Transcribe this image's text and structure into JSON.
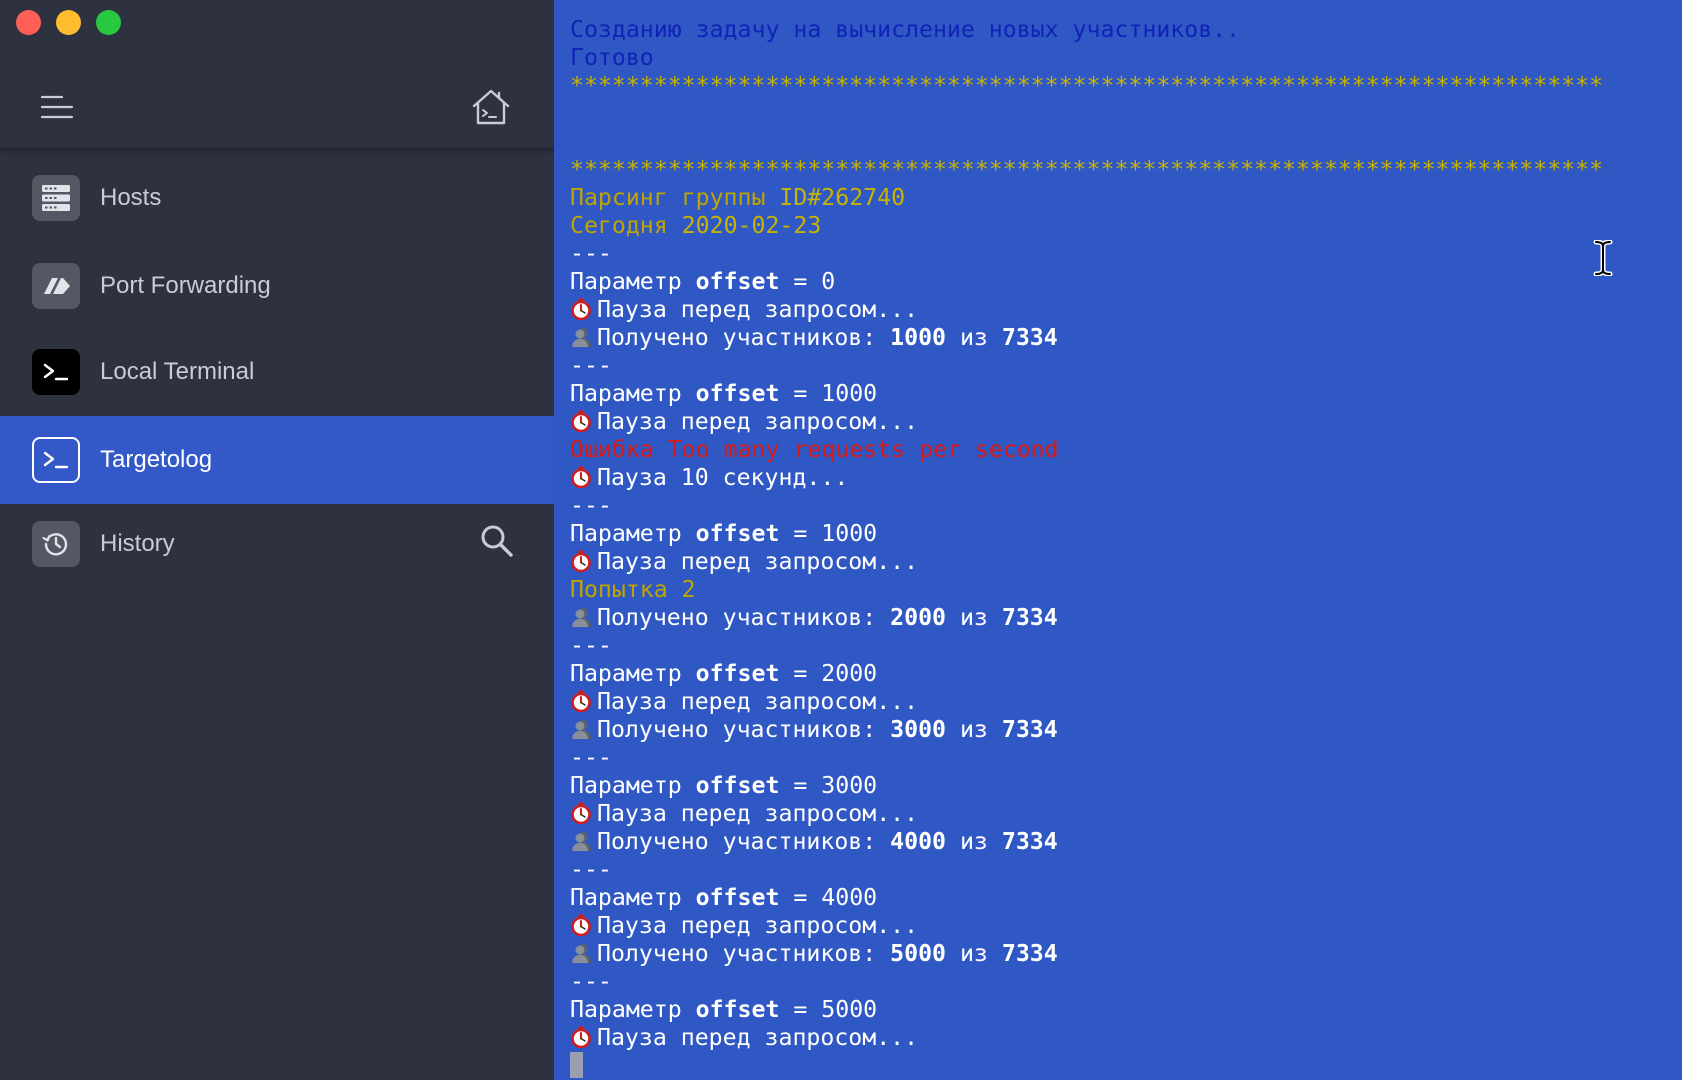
{
  "sidebar": {
    "items": [
      {
        "label": "Hosts",
        "icon": "server-icon"
      },
      {
        "label": "Port Forwarding",
        "icon": "port-forwarding-icon"
      },
      {
        "label": "Local Terminal",
        "icon": "terminal-prompt-icon"
      },
      {
        "label": "Targetolog",
        "icon": "terminal-prompt-icon",
        "active": true
      },
      {
        "label": "History",
        "icon": "history-icon"
      }
    ]
  },
  "terminal": {
    "lines": [
      {
        "segments": [
          {
            "t": "Созданию задачу на вычисление новых участников..",
            "c": "c-blue"
          }
        ]
      },
      {
        "segments": [
          {
            "t": "Готово",
            "c": "c-blue"
          }
        ]
      },
      {
        "segments": [
          {
            "t": "**************************************************************************",
            "c": "c-yellow"
          }
        ]
      },
      {
        "segments": []
      },
      {
        "segments": []
      },
      {
        "segments": [
          {
            "t": "**************************************************************************",
            "c": "c-yellow"
          }
        ]
      },
      {
        "segments": [
          {
            "t": "Парсинг группы ",
            "c": "c-olive"
          },
          {
            "t": "ID#262740",
            "c": "c-yellow"
          }
        ]
      },
      {
        "segments": [
          {
            "t": "Сегодня ",
            "c": "c-olive"
          },
          {
            "t": "2020-02-23",
            "c": "c-yellow"
          }
        ]
      },
      {
        "segments": [
          {
            "t": "---",
            "c": "c-white"
          }
        ]
      },
      {
        "segments": [
          {
            "t": "Параметр ",
            "c": "c-white"
          },
          {
            "t": "offset",
            "c": "c-white bold"
          },
          {
            "t": " = 0",
            "c": "c-white"
          }
        ]
      },
      {
        "icon": "timer",
        "segments": [
          {
            "t": "Пауза перед запросом...",
            "c": "c-white"
          }
        ]
      },
      {
        "icon": "user",
        "segments": [
          {
            "t": "Получено участников: ",
            "c": "c-white"
          },
          {
            "t": "1000",
            "c": "c-white bold"
          },
          {
            "t": " из ",
            "c": "c-white"
          },
          {
            "t": "7334",
            "c": "c-white bold"
          }
        ]
      },
      {
        "segments": [
          {
            "t": "---",
            "c": "c-white"
          }
        ]
      },
      {
        "segments": [
          {
            "t": "Параметр ",
            "c": "c-white"
          },
          {
            "t": "offset",
            "c": "c-white bold"
          },
          {
            "t": " = 1000",
            "c": "c-white"
          }
        ]
      },
      {
        "icon": "timer",
        "segments": [
          {
            "t": "Пауза перед запросом...",
            "c": "c-white"
          }
        ]
      },
      {
        "segments": [
          {
            "t": "Ошибка Too many requests per second",
            "c": "c-red"
          }
        ]
      },
      {
        "icon": "timer",
        "segments": [
          {
            "t": "Пауза 10 секунд...",
            "c": "c-white"
          }
        ]
      },
      {
        "segments": [
          {
            "t": "---",
            "c": "c-white"
          }
        ]
      },
      {
        "segments": [
          {
            "t": "Параметр ",
            "c": "c-white"
          },
          {
            "t": "offset",
            "c": "c-white bold"
          },
          {
            "t": " = 1000",
            "c": "c-white"
          }
        ]
      },
      {
        "icon": "timer",
        "segments": [
          {
            "t": "Пауза перед запросом...",
            "c": "c-white"
          }
        ]
      },
      {
        "segments": [
          {
            "t": "Попытка 2",
            "c": "c-olive"
          }
        ]
      },
      {
        "icon": "user",
        "segments": [
          {
            "t": "Получено участников: ",
            "c": "c-white"
          },
          {
            "t": "2000",
            "c": "c-white bold"
          },
          {
            "t": " из ",
            "c": "c-white"
          },
          {
            "t": "7334",
            "c": "c-white bold"
          }
        ]
      },
      {
        "segments": [
          {
            "t": "---",
            "c": "c-white"
          }
        ]
      },
      {
        "segments": [
          {
            "t": "Параметр ",
            "c": "c-white"
          },
          {
            "t": "offset",
            "c": "c-white bold"
          },
          {
            "t": " = 2000",
            "c": "c-white"
          }
        ]
      },
      {
        "icon": "timer",
        "segments": [
          {
            "t": "Пауза перед запросом...",
            "c": "c-white"
          }
        ]
      },
      {
        "icon": "user",
        "segments": [
          {
            "t": "Получено участников: ",
            "c": "c-white"
          },
          {
            "t": "3000",
            "c": "c-white bold"
          },
          {
            "t": " из ",
            "c": "c-white"
          },
          {
            "t": "7334",
            "c": "c-white bold"
          }
        ]
      },
      {
        "segments": [
          {
            "t": "---",
            "c": "c-white"
          }
        ]
      },
      {
        "segments": [
          {
            "t": "Параметр ",
            "c": "c-white"
          },
          {
            "t": "offset",
            "c": "c-white bold"
          },
          {
            "t": " = 3000",
            "c": "c-white"
          }
        ]
      },
      {
        "icon": "timer",
        "segments": [
          {
            "t": "Пауза перед запросом...",
            "c": "c-white"
          }
        ]
      },
      {
        "icon": "user",
        "segments": [
          {
            "t": "Получено участников: ",
            "c": "c-white"
          },
          {
            "t": "4000",
            "c": "c-white bold"
          },
          {
            "t": " из ",
            "c": "c-white"
          },
          {
            "t": "7334",
            "c": "c-white bold"
          }
        ]
      },
      {
        "segments": [
          {
            "t": "---",
            "c": "c-white"
          }
        ]
      },
      {
        "segments": [
          {
            "t": "Параметр ",
            "c": "c-white"
          },
          {
            "t": "offset",
            "c": "c-white bold"
          },
          {
            "t": " = 4000",
            "c": "c-white"
          }
        ]
      },
      {
        "icon": "timer",
        "segments": [
          {
            "t": "Пауза перед запросом...",
            "c": "c-white"
          }
        ]
      },
      {
        "icon": "user",
        "segments": [
          {
            "t": "Получено участников: ",
            "c": "c-white"
          },
          {
            "t": "5000",
            "c": "c-white bold"
          },
          {
            "t": " из ",
            "c": "c-white"
          },
          {
            "t": "7334",
            "c": "c-white bold"
          }
        ]
      },
      {
        "segments": [
          {
            "t": "---",
            "c": "c-white"
          }
        ]
      },
      {
        "segments": [
          {
            "t": "Параметр ",
            "c": "c-white"
          },
          {
            "t": "offset",
            "c": "c-white bold"
          },
          {
            "t": " = 5000",
            "c": "c-white"
          }
        ]
      },
      {
        "icon": "timer",
        "segments": [
          {
            "t": "Пауза перед запросом...",
            "c": "c-white"
          }
        ]
      }
    ]
  },
  "colors": {
    "sidebar_bg": "#2e3140",
    "active_item": "#3358c8",
    "terminal_bg": "#3058c4",
    "text_blue": "#0f23b8",
    "text_yellow": "#c7b300",
    "text_red": "#d81a16"
  }
}
